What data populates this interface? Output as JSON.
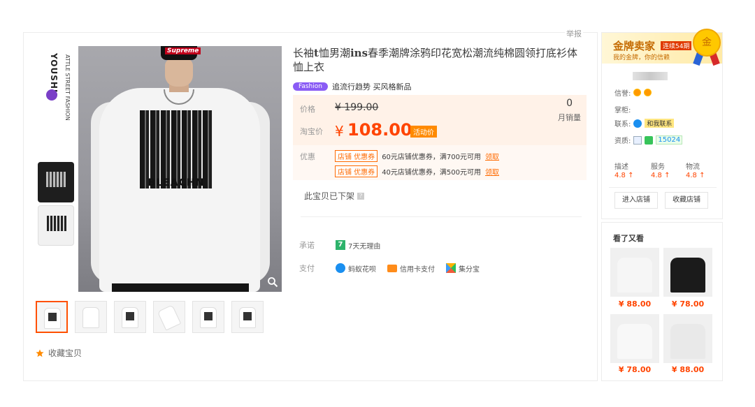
{
  "report_label": "举报",
  "brand": {
    "name": "YOUSHU",
    "sub": "ATTLE STREET FASHION"
  },
  "main_image": {
    "cap_logo": "Supreme",
    "print_text": "BLEACHN"
  },
  "favorite_label": "收藏宝贝",
  "title": {
    "part1": "长袖",
    "bold1": "t",
    "part2": "恤男潮",
    "bold2": "ins",
    "part3": "春季潮牌涂鸦印花宽松潮流纯棉圆领打底衫体恤上衣"
  },
  "tag": {
    "badge": "Fashion",
    "text": "追流行趋势 买风格新品"
  },
  "price": {
    "label": "价格",
    "original": "¥ 199.00",
    "taobao_label": "淘宝价",
    "currency": "¥",
    "current": "108.00",
    "promo_badge": "活动价",
    "sales_count": "0",
    "sales_label": "月销量"
  },
  "coupons": {
    "label": "优惠",
    "items": [
      {
        "tag": "店铺  优惠券",
        "desc": "60元店铺优惠券，满700元可用",
        "action": "领取"
      },
      {
        "tag": "店铺  优惠券",
        "desc": "40元店铺优惠券，满500元可用",
        "action": "领取"
      }
    ]
  },
  "offshelf_text": "此宝贝已下架",
  "promise": {
    "label": "承诺",
    "item": "7天无理由",
    "icon_char": "7"
  },
  "payment": {
    "label": "支付",
    "items": [
      "蚂蚁花呗",
      "信用卡支付",
      "集分宝"
    ]
  },
  "seller": {
    "gold_title": "金牌卖家",
    "streak": "连续54期",
    "gold_sub": "我的金牌，你的信赖",
    "medal_char": "金",
    "credit_label": "信誉:",
    "keeper_label": "掌柜:",
    "contact_label": "联系:",
    "contact_chip": "和我联系",
    "qual_label": "资质:",
    "qual_count": "15024",
    "scores": [
      {
        "label": "描述",
        "value": "4.8 ↑"
      },
      {
        "label": "服务",
        "value": "4.8 ↑"
      },
      {
        "label": "物流",
        "value": "4.8 ↑"
      }
    ],
    "enter_shop": "进入店铺",
    "fav_shop": "收藏店铺"
  },
  "recommend": {
    "title": "看了又看",
    "items": [
      {
        "price": "¥ 88.00",
        "tee_color": "#f6f6f6"
      },
      {
        "price": "¥ 78.00",
        "tee_color": "#1b1b1b"
      },
      {
        "price": "¥ 78.00",
        "tee_color": "#f8f8f8"
      },
      {
        "price": "¥ 88.00",
        "tee_color": "#e9e9e9"
      }
    ]
  },
  "colors": {
    "accent": "#ff4400",
    "brand_orange": "#ff5000",
    "price_bg": "#fff2e8"
  }
}
